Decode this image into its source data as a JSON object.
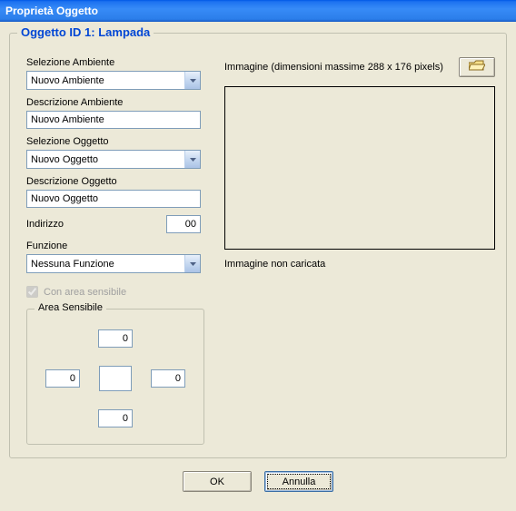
{
  "window": {
    "title": "Proprietà Oggetto"
  },
  "group": {
    "title": "Oggetto ID 1: Lampada"
  },
  "left": {
    "selAmbLabel": "Selezione Ambiente",
    "selAmbValue": "Nuovo Ambiente",
    "descAmbLabel": "Descrizione Ambiente",
    "descAmbValue": "Nuovo Ambiente",
    "selOggLabel": "Selezione Oggetto",
    "selOggValue": "Nuovo Oggetto",
    "descOggLabel": "Descrizione Oggetto",
    "descOggValue": "Nuovo Oggetto",
    "indirizzoLabel": "Indirizzo",
    "indirizzoValue": "00",
    "funzioneLabel": "Funzione",
    "funzioneValue": "Nessuna Funzione",
    "chkLabel": "Con area sensibile"
  },
  "area": {
    "title": "Area Sensibile",
    "top": "0",
    "left": "0",
    "right": "0",
    "bottom": "0"
  },
  "right": {
    "immagineLabel": "Immagine (dimensioni massime 288 x 176 pixels)",
    "status": "Immagine non caricata"
  },
  "buttons": {
    "ok": "OK",
    "cancel": "Annulla"
  }
}
